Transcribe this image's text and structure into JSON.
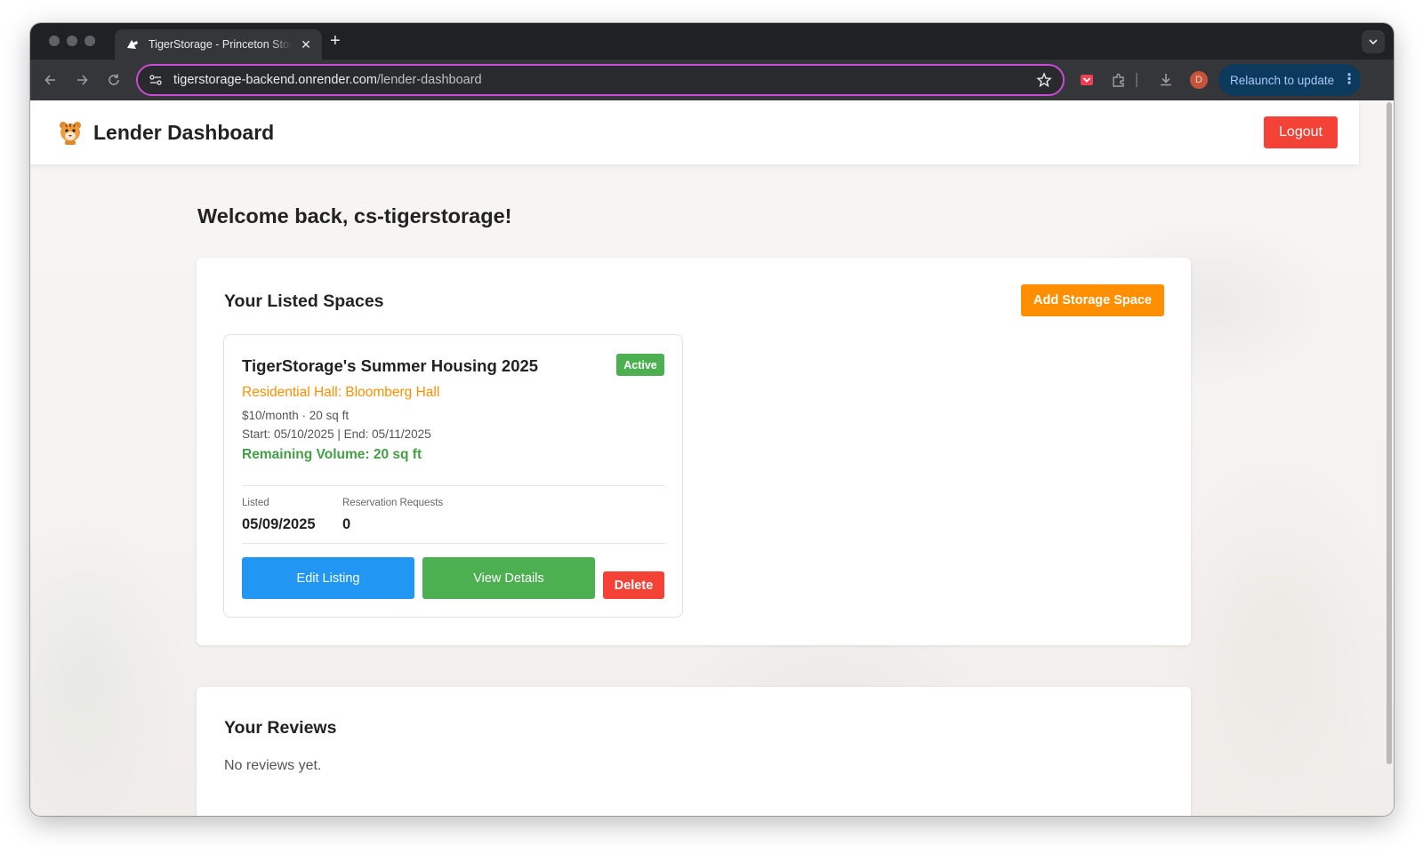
{
  "browser": {
    "tab_title": "TigerStorage - Princeton Storage",
    "url_host": "tigerstorage-backend.onrender.com",
    "url_path": "/lender-dashboard",
    "profile_initial": "D",
    "relaunch_label": "Relaunch to update",
    "accent_color": "#c94bd6"
  },
  "header": {
    "title": "Lender Dashboard",
    "logout_label": "Logout"
  },
  "welcome": "Welcome back, cs-tigerstorage!",
  "spaces": {
    "title": "Your Listed Spaces",
    "add_label": "Add Storage Space",
    "listings": [
      {
        "title": "TigerStorage's Summer Housing 2025",
        "status": "Active",
        "hall": "Residential Hall: Bloomberg Hall",
        "price_size": "$10/month · 20 sq ft",
        "dates": "Start: 05/10/2025 | End: 05/11/2025",
        "remaining": "Remaining Volume: 20 sq ft",
        "listed_label": "Listed",
        "listed_value": "05/09/2025",
        "requests_label": "Reservation Requests",
        "requests_value": "0",
        "edit_label": "Edit Listing",
        "view_label": "View Details",
        "delete_label": "Delete"
      }
    ]
  },
  "reviews": {
    "title": "Your Reviews",
    "empty_text": "No reviews yet."
  },
  "colors": {
    "primary_orange": "#ff8f00",
    "danger_red": "#f44336",
    "success_green": "#4caf50",
    "info_blue": "#2196f3"
  }
}
